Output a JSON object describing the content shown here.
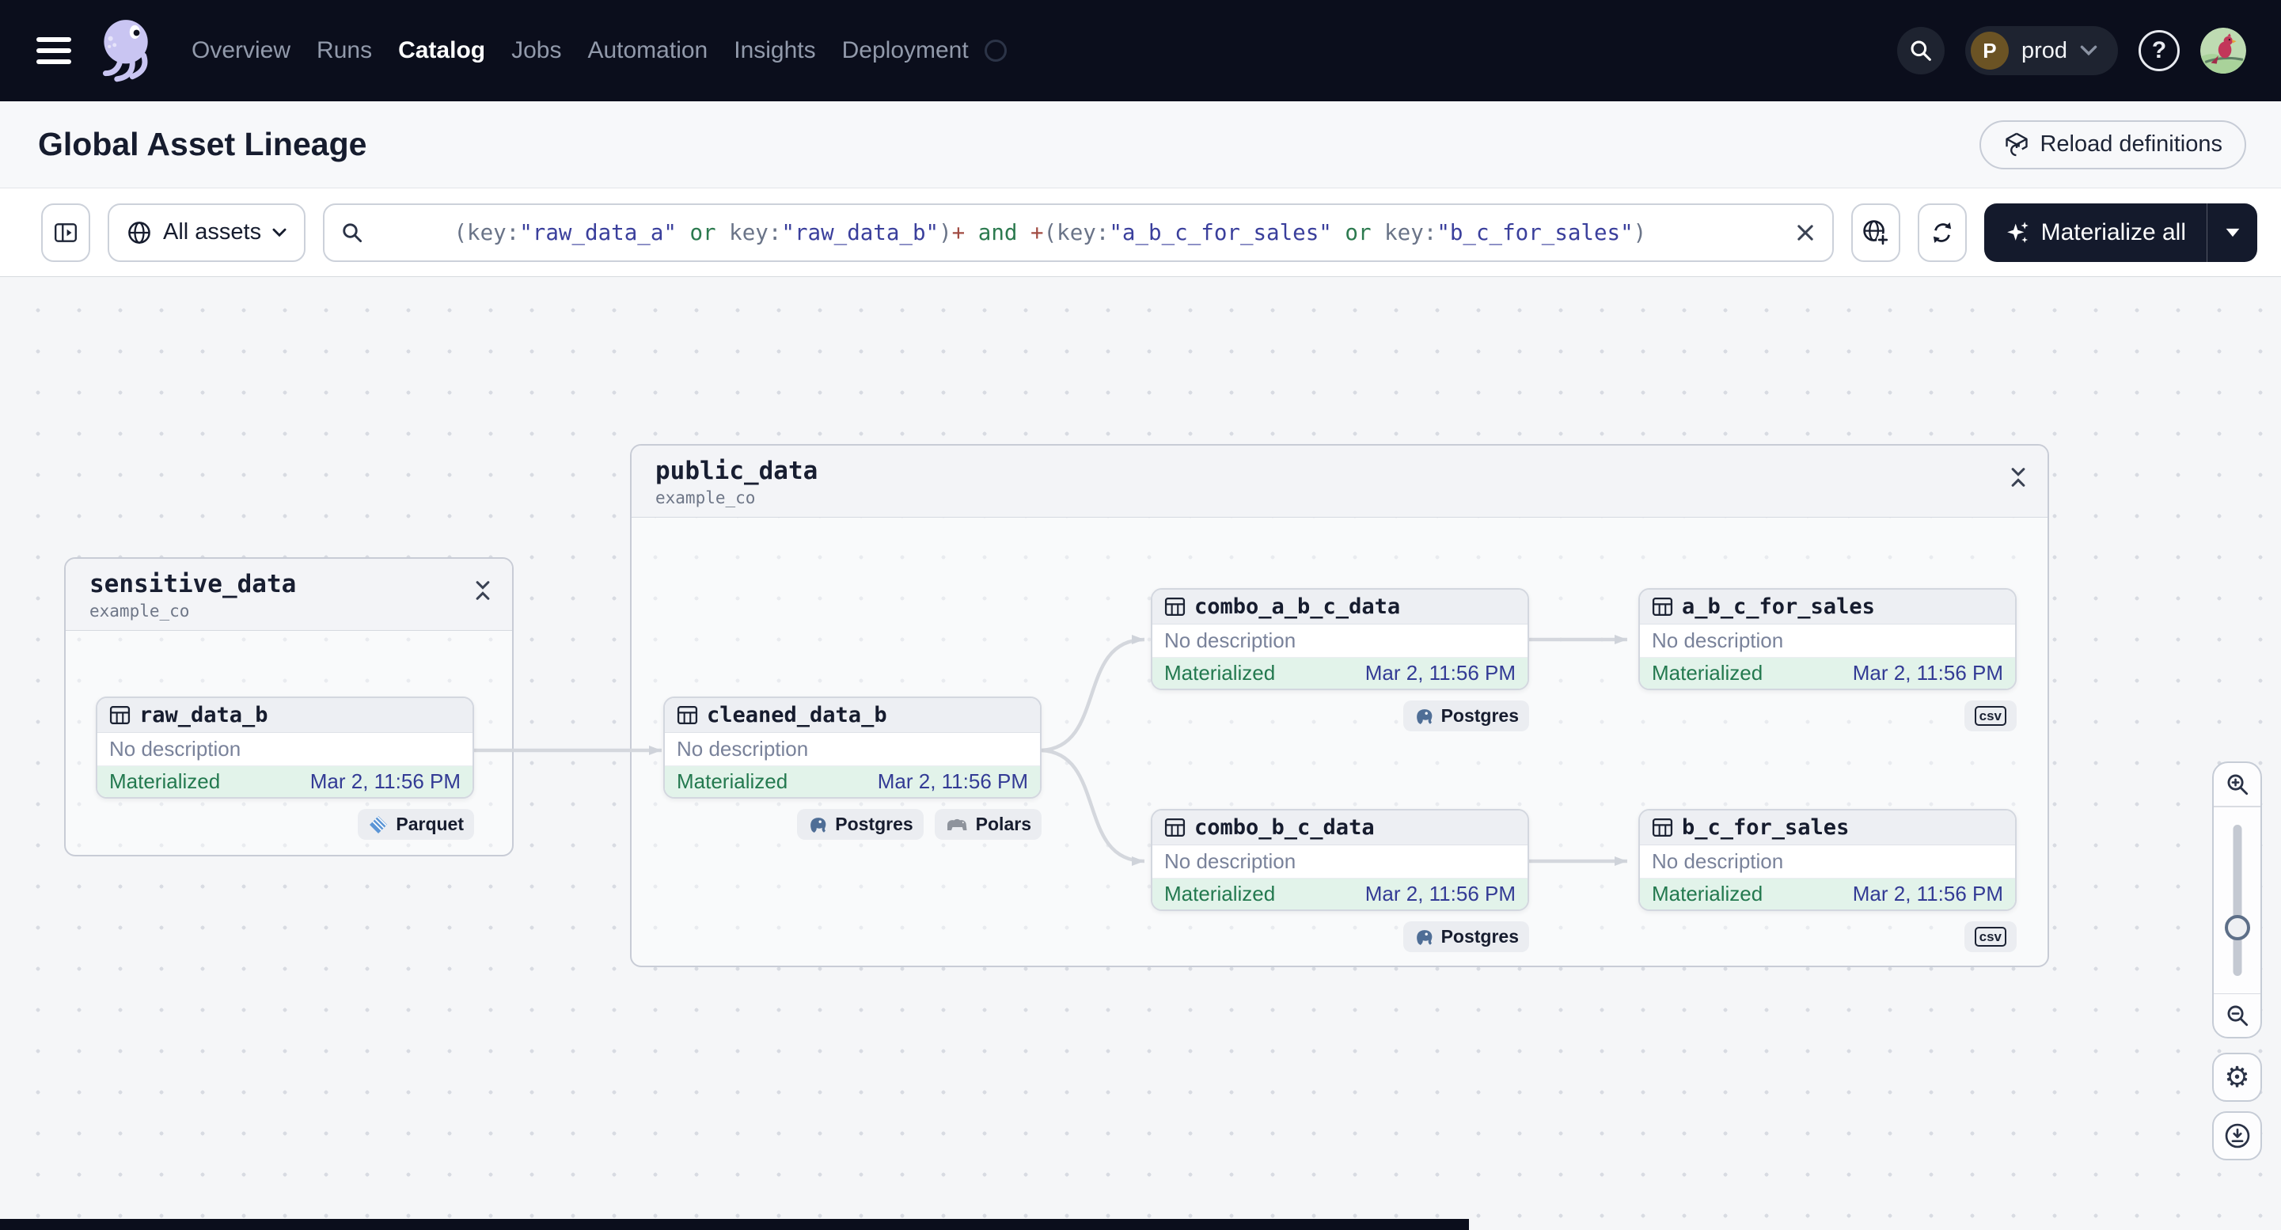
{
  "nav": {
    "items": [
      "Overview",
      "Runs",
      "Catalog",
      "Jobs",
      "Automation",
      "Insights",
      "Deployment"
    ],
    "active_item": "Catalog",
    "deployment_switcher": {
      "initial": "P",
      "label": "prod"
    }
  },
  "page": {
    "title": "Global Asset Lineage",
    "reload_button": "Reload definitions"
  },
  "toolbar": {
    "scope_button": "All assets",
    "materialize_button": "Materialize all",
    "query": [
      {
        "text": "(key:",
        "kind": "punct"
      },
      {
        "text": "\"raw_data_a\"",
        "kind": "string"
      },
      {
        "text": " or ",
        "kind": "op"
      },
      {
        "text": "key:",
        "kind": "punct"
      },
      {
        "text": "\"raw_data_b\"",
        "kind": "string"
      },
      {
        "text": ")",
        "kind": "punct"
      },
      {
        "text": "+",
        "kind": "plus"
      },
      {
        "text": " and ",
        "kind": "op"
      },
      {
        "text": "+",
        "kind": "plus"
      },
      {
        "text": "(key:",
        "kind": "punct"
      },
      {
        "text": "\"a_b_c_for_sales\"",
        "kind": "string"
      },
      {
        "text": " or ",
        "kind": "op"
      },
      {
        "text": "key:",
        "kind": "punct"
      },
      {
        "text": "\"b_c_for_sales\"",
        "kind": "string"
      },
      {
        "text": ")",
        "kind": "punct"
      }
    ]
  },
  "graph": {
    "groups": [
      {
        "name": "sensitive_data",
        "location": "example_co"
      },
      {
        "name": "public_data",
        "location": "example_co"
      }
    ],
    "nodes": [
      {
        "name": "raw_data_b",
        "description": "No description",
        "status": "Materialized",
        "timestamp": "Mar 2, 11:56 PM",
        "badges": [
          {
            "label": "Parquet"
          }
        ]
      },
      {
        "name": "cleaned_data_b",
        "description": "No description",
        "status": "Materialized",
        "timestamp": "Mar 2, 11:56 PM",
        "badges": [
          {
            "label": "Postgres"
          },
          {
            "label": "Polars"
          }
        ]
      },
      {
        "name": "combo_a_b_c_data",
        "description": "No description",
        "status": "Materialized",
        "timestamp": "Mar 2, 11:56 PM",
        "badges": [
          {
            "label": "Postgres"
          }
        ]
      },
      {
        "name": "a_b_c_for_sales",
        "description": "No description",
        "status": "Materialized",
        "timestamp": "Mar 2, 11:56 PM",
        "badges": [
          {
            "label": "csv"
          }
        ]
      },
      {
        "name": "combo_b_c_data",
        "description": "No description",
        "status": "Materialized",
        "timestamp": "Mar 2, 11:56 PM",
        "badges": [
          {
            "label": "Postgres"
          }
        ]
      },
      {
        "name": "b_c_for_sales",
        "description": "No description",
        "status": "Materialized",
        "timestamp": "Mar 2, 11:56 PM",
        "badges": [
          {
            "label": "csv"
          }
        ]
      }
    ]
  },
  "colors": {
    "nav_bg": "#0b0e1c",
    "materialized_green": "#23794f",
    "timestamp_indigo": "#333b95",
    "query_string": "#3a3f9c",
    "query_keyword": "#2c7a4f",
    "query_plus": "#a14b42",
    "edge_gray": "#d4d7dd"
  }
}
